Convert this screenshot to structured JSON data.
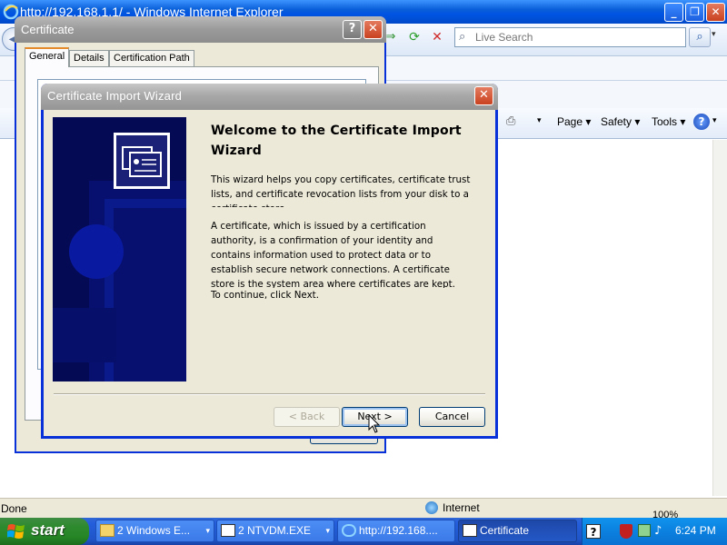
{
  "ie": {
    "title": "http://192.168.1.1/ - Windows Internet Explorer",
    "search_placeholder": "Live Search",
    "commands": {
      "page": "Page ▾",
      "safety": "Safety ▾",
      "tools": "Tools ▾"
    },
    "status_text": "Done",
    "zone_text": "Internet",
    "zoom_text": "100%"
  },
  "cert_dialog": {
    "title": "Certificate",
    "tabs": [
      "General",
      "Details",
      "Certification Path"
    ]
  },
  "wizard": {
    "title": "Certificate Import Wizard",
    "heading": "Welcome to the Certificate Import Wizard",
    "paragraph1": "This wizard helps you copy certificates, certificate trust lists, and certificate revocation lists from your disk to a certificate store.",
    "paragraph2": "A certificate, which is issued by a certification authority, is a confirmation of your identity and contains information used to protect data or to establish secure network connections. A certificate store is the system area where certificates are kept.",
    "paragraph3": "To continue, click Next.",
    "buttons": {
      "back": "< Back",
      "next": "Next >",
      "cancel": "Cancel"
    }
  },
  "taskbar": {
    "start": "start",
    "tasks": [
      "2 Windows E...",
      "2 NTVDM.EXE",
      "http://192.168....",
      "Certificate"
    ],
    "clock": "6:24 PM"
  },
  "colors": {
    "xp_blue": "#0054e3",
    "dialog_face": "#ece9d8",
    "wizard_banner": "#050a55",
    "start_green": "#2f8a2f"
  }
}
